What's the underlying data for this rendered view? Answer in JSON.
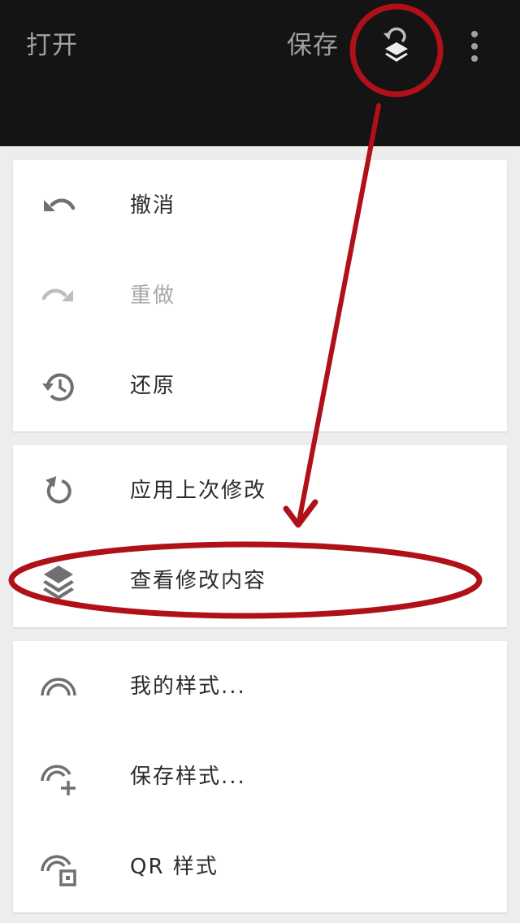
{
  "toolbar": {
    "open_label": "打开",
    "save_label": "保存",
    "icons": {
      "layers": "layers-undo-icon",
      "more": "more-vert-icon"
    },
    "background": "#141414",
    "text_color": "#a0a0a0"
  },
  "menu": {
    "history_group": [
      {
        "label": "撤消",
        "icon": "undo-icon",
        "enabled": true
      },
      {
        "label": "重做",
        "icon": "redo-icon",
        "enabled": false
      },
      {
        "label": "还原",
        "icon": "history-icon",
        "enabled": true
      }
    ],
    "edits_group": [
      {
        "label": "应用上次修改",
        "icon": "reapply-icon",
        "enabled": true
      },
      {
        "label": "查看修改内容",
        "icon": "layers-icon",
        "enabled": true
      }
    ],
    "styles_group": [
      {
        "label": "我的样式...",
        "icon": "style-arc-icon",
        "enabled": true
      },
      {
        "label": "保存样式...",
        "icon": "style-add-icon",
        "enabled": true
      },
      {
        "label": "QR 样式",
        "icon": "style-qr-icon",
        "enabled": true
      }
    ]
  },
  "annotation": {
    "color": "#b01018"
  },
  "colors": {
    "menu_text": "#2b2b2b",
    "icon": "#707070",
    "disabled": "#bdbdbd",
    "page_bg": "#ededed"
  }
}
